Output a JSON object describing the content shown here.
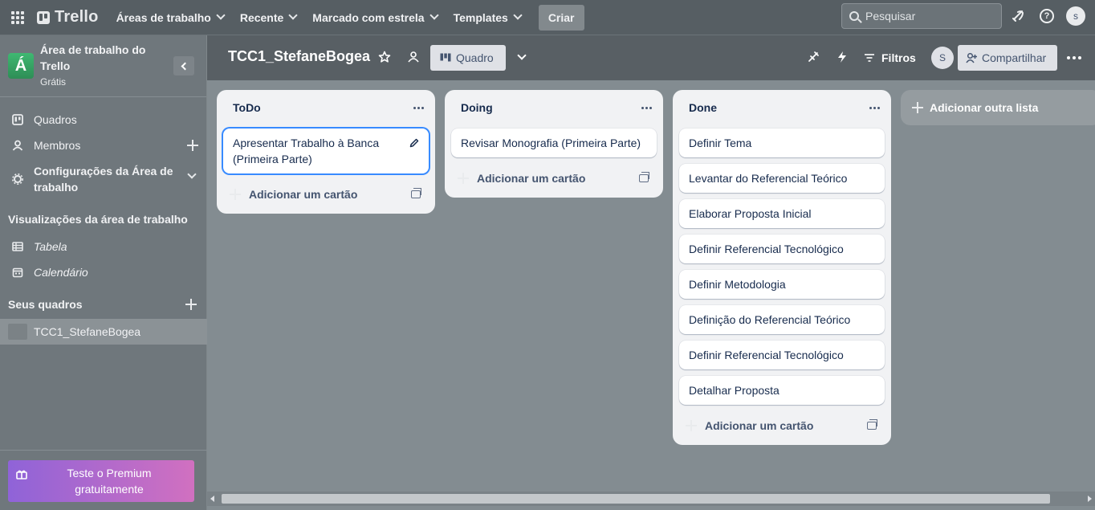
{
  "topbar": {
    "app_name": "Trello",
    "nav": [
      {
        "label": "Áreas de trabalho"
      },
      {
        "label": "Recente"
      },
      {
        "label": "Marcado com estrela"
      },
      {
        "label": "Templates"
      }
    ],
    "create_label": "Criar",
    "search_placeholder": "Pesquisar",
    "user_initial": "s"
  },
  "sidebar": {
    "workspace_initial": "Á",
    "workspace_name": "Área de trabalho do Trello",
    "workspace_plan": "Grátis",
    "items": [
      {
        "label": "Quadros",
        "icon": "board-icon"
      },
      {
        "label": "Membros",
        "icon": "person-icon"
      },
      {
        "label": "Configurações da Área de trabalho",
        "icon": "gear-icon"
      }
    ],
    "views_title": "Visualizações da área de trabalho",
    "views": [
      {
        "label": "Tabela",
        "icon": "table-icon"
      },
      {
        "label": "Calendário",
        "icon": "calendar-icon"
      }
    ],
    "boards_title": "Seus quadros",
    "boards": [
      {
        "label": "TCC1_StefaneBogea"
      }
    ],
    "premium_label": "Teste o Premium gratuitamente"
  },
  "board": {
    "title": "TCC1_StefaneBogea",
    "view_label": "Quadro",
    "filters_label": "Filtros",
    "member_initial": "S",
    "share_label": "Compartilhar"
  },
  "lists": [
    {
      "title": "ToDo",
      "cards": [
        "Apresentar Trabalho à Banca (Primeira Parte)"
      ],
      "add_label": "Adicionar um cartão"
    },
    {
      "title": "Doing",
      "cards": [
        "Revisar Monografia (Primeira Parte)"
      ],
      "add_label": "Adicionar um cartão"
    },
    {
      "title": "Done",
      "cards": [
        "Definir Tema",
        "Levantar do Referencial Teórico",
        "Elaborar Proposta Inicial",
        "Definir Referencial Tecnológico",
        "Definir Metodologia",
        "Definição do Referencial Teórico",
        "Definir Referencial Tecnológico",
        "Detalhar Proposta"
      ],
      "add_label": "Adicionar um cartão"
    }
  ],
  "add_list_label": "Adicionar outra lista",
  "colors": {
    "accent": "#388bff",
    "workspace_tile": "#35a764",
    "premium_start": "#8f63d8",
    "premium_end": "#d170c0"
  }
}
